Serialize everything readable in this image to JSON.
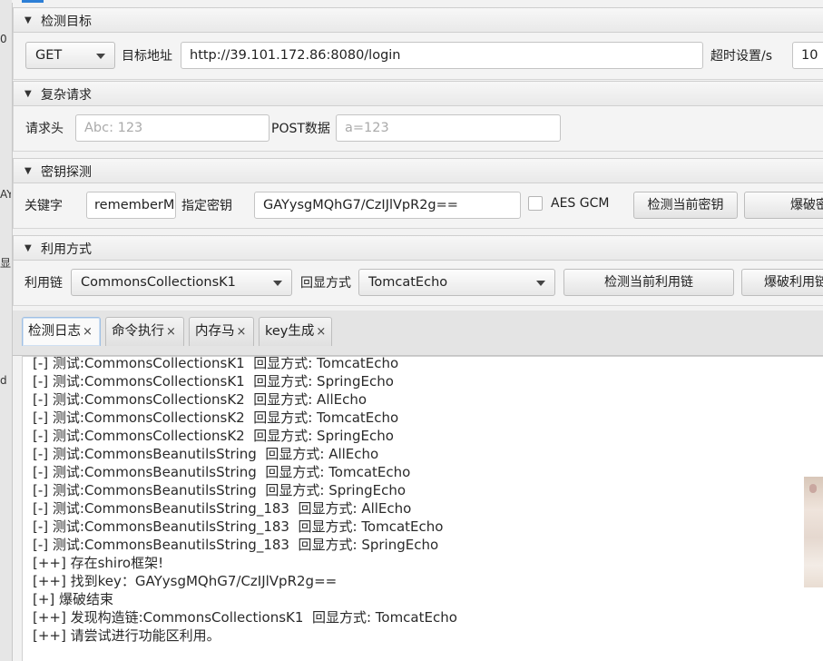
{
  "left_strip_fragments": [
    "0",
    "AY",
    "显",
    "d"
  ],
  "sections": {
    "target": {
      "title": "检测目标",
      "method": "GET",
      "url_label": "目标地址",
      "url_value": "http://39.101.172.86:8080/login",
      "timeout_label": "超时设置/s",
      "timeout_value": "10"
    },
    "complex": {
      "title": "复杂请求",
      "header_label": "请求头",
      "header_placeholder": "Abc: 123",
      "post_label": "POST数据",
      "post_placeholder": "a=123"
    },
    "key": {
      "title": "密钥探测",
      "keyword_label": "关键字",
      "keyword_value": "rememberMe",
      "key_label": "指定密钥",
      "key_value": "GAYysgMQhG7/CzIJlVpR2g==",
      "aes_gcm_label": "AES GCM",
      "check_key_button": "检测当前密钥",
      "brute_key_button": "爆破密钥"
    },
    "exploit": {
      "title": "利用方式",
      "chain_label": "利用链",
      "chain_value": "CommonsCollectionsK1",
      "echo_label": "回显方式",
      "echo_value": "TomcatEcho",
      "check_chain_button": "检测当前利用链",
      "brute_chain_button": "爆破利用链"
    }
  },
  "tabs": [
    {
      "label": "检测日志",
      "close": "×"
    },
    {
      "label": "命令执行",
      "close": "×"
    },
    {
      "label": "内存马",
      "close": "×"
    },
    {
      "label": "key生成",
      "close": "×"
    }
  ],
  "log_lines": [
    "[-] 测试:CommonsCollectionsK1  回显方式: TomcatEcho",
    "[-] 测试:CommonsCollectionsK1  回显方式: SpringEcho",
    "[-] 测试:CommonsCollectionsK2  回显方式: AllEcho",
    "[-] 测试:CommonsCollectionsK2  回显方式: TomcatEcho",
    "[-] 测试:CommonsCollectionsK2  回显方式: SpringEcho",
    "[-] 测试:CommonsBeanutilsString  回显方式: AllEcho",
    "[-] 测试:CommonsBeanutilsString  回显方式: TomcatEcho",
    "[-] 测试:CommonsBeanutilsString  回显方式: SpringEcho",
    "[-] 测试:CommonsBeanutilsString_183  回显方式: AllEcho",
    "[-] 测试:CommonsBeanutilsString_183  回显方式: TomcatEcho",
    "[-] 测试:CommonsBeanutilsString_183  回显方式: SpringEcho",
    "[++] 存在shiro框架!",
    "[++] 找到key：GAYysgMQhG7/CzIJlVpR2g==",
    "[+] 爆破结束",
    "[++] 发现构造链:CommonsCollectionsK1  回显方式: TomcatEcho",
    "[++] 请尝试进行功能区利用。"
  ],
  "icons": {
    "section_arrow": "triangle-down-icon",
    "tab_close": "close-icon",
    "combo_caret": "chevron-down-icon"
  },
  "colors": {
    "accent": "#2d7fd6",
    "panel_bg": "#f4f4f4",
    "log_bg": "#ffffff"
  }
}
